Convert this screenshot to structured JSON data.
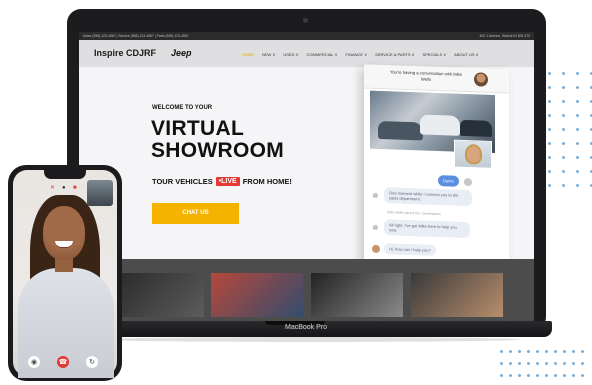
{
  "site": {
    "topbar_left": "Sales (555) 123-4567 | Service (555) 123-4567 | Parts (555) 123-4567",
    "topbar_right": "402 1 Avenue, Walnut IN 505 470",
    "brand": "Inspire CDJRF",
    "logo_text": "Jeep",
    "nav": [
      "HOME",
      "NEW ∨",
      "USED ∨",
      "COMMERCIAL ∨",
      "FINANCE ∨",
      "SERVICE & PARTS ∨",
      "SPECIALS ∨",
      "ABOUT US ∨"
    ]
  },
  "hero": {
    "welcome": "WELCOME TO YOUR",
    "title_line1": "VIRTUAL",
    "title_line2": "SHOWROOM",
    "tour_before": "TOUR VEHICLES",
    "live_badge": "•LIVE",
    "tour_after": "FROM HOME!",
    "cta": "CHAT US"
  },
  "chat": {
    "header": "You're having a conversation with Mike Wells",
    "msg_user": "Demo",
    "msg_bot1": "One moment while I connect you to the sales department.",
    "note": "Mike Wells joined the conversation",
    "msg_agent1": "All right, I've got Mike here to help you now.",
    "msg_agent2": "Hi, how can I help you?"
  },
  "laptop_label": "MacBook Pro",
  "colors": {
    "accent_yellow": "#f5b300",
    "live_red": "#e53935",
    "chat_blue": "#5b8ee0",
    "dot_blue": "#7fb0d8"
  },
  "icons": {
    "mic": "mic-icon",
    "hangup": "hangup-icon",
    "flip": "flip-camera-icon",
    "close": "close-icon",
    "video": "video-icon"
  }
}
